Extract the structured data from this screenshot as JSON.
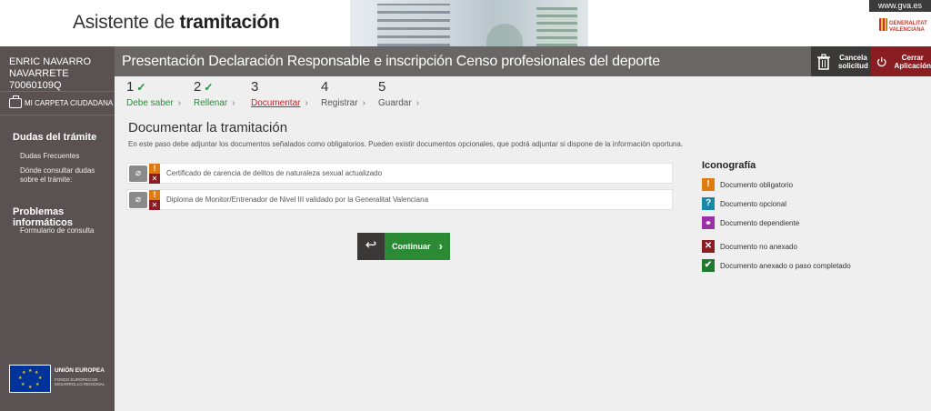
{
  "header": {
    "app_title_prefix": "Asistente de",
    "app_title_bold": "tramitación",
    "gva_url": "www.gva.es",
    "gva_logo_text_1": "GENERALITAT",
    "gva_logo_text_2": "VALENCIANA"
  },
  "sidebar": {
    "user_name": "ENRIC NAVARRO NAVARRETE",
    "user_id": "70060109Q",
    "carpeta_label": "MI CARPETA CIUDADANA",
    "sections": [
      {
        "title": "Dudas del trámite",
        "links": [
          "Dudas Frecuentes",
          "Dónde consultar dudas sobre el trámite:"
        ]
      },
      {
        "title": "Problemas informáticos",
        "links": [
          "Formulario de consulta"
        ]
      }
    ],
    "eu_title": "UNIÓN EUROPEA",
    "eu_subtitle": "FONDO EUROPEO DE DESARROLLO REGIONAL"
  },
  "titlebar": {
    "title": "Presentación Declaración Responsable e inscripción Censo profesionales del deporte",
    "cancel_label_1": "Cancela",
    "cancel_label_2": "solicitud",
    "close_label_1": "Cerrar",
    "close_label_2": "Aplicación"
  },
  "steps": [
    {
      "num": "1",
      "label": "Debe saber",
      "state": "done"
    },
    {
      "num": "2",
      "label": "Rellenar",
      "state": "done"
    },
    {
      "num": "3",
      "label": "Documentar",
      "state": "active"
    },
    {
      "num": "4",
      "label": "Registrar",
      "state": "pending"
    },
    {
      "num": "5",
      "label": "Guardar",
      "state": "pending"
    }
  ],
  "main": {
    "title": "Documentar la tramitación",
    "description": "En este paso debe adjuntar los documentos señalados como obligatorios. Pueden existir documentos opcionales, que podrá adjuntar si dispone de la información oportuna.",
    "documents": [
      "Certificado de carencia de delitos de naturaleza sexual actualizado",
      "Diploma de Monitor/Entrenador de Nivel III validado por la Generalitat Valenciana"
    ],
    "continue_label": "Continuar"
  },
  "iconografia": {
    "title": "Iconografía",
    "items": [
      {
        "label": "Documento obligatorio",
        "symbol": "!",
        "color": "#e07b10"
      },
      {
        "label": "Documento opcional",
        "symbol": "?",
        "color": "#1a88a8"
      },
      {
        "label": "Documento dependiente",
        "symbol": "🔗",
        "color": "#9b2fa8"
      },
      {
        "label": "Documento no anexado",
        "symbol": "✕",
        "color": "#8a1d22"
      },
      {
        "label": "Documento anexado o paso completado",
        "symbol": "✔",
        "color": "#1f7a2e"
      }
    ]
  }
}
